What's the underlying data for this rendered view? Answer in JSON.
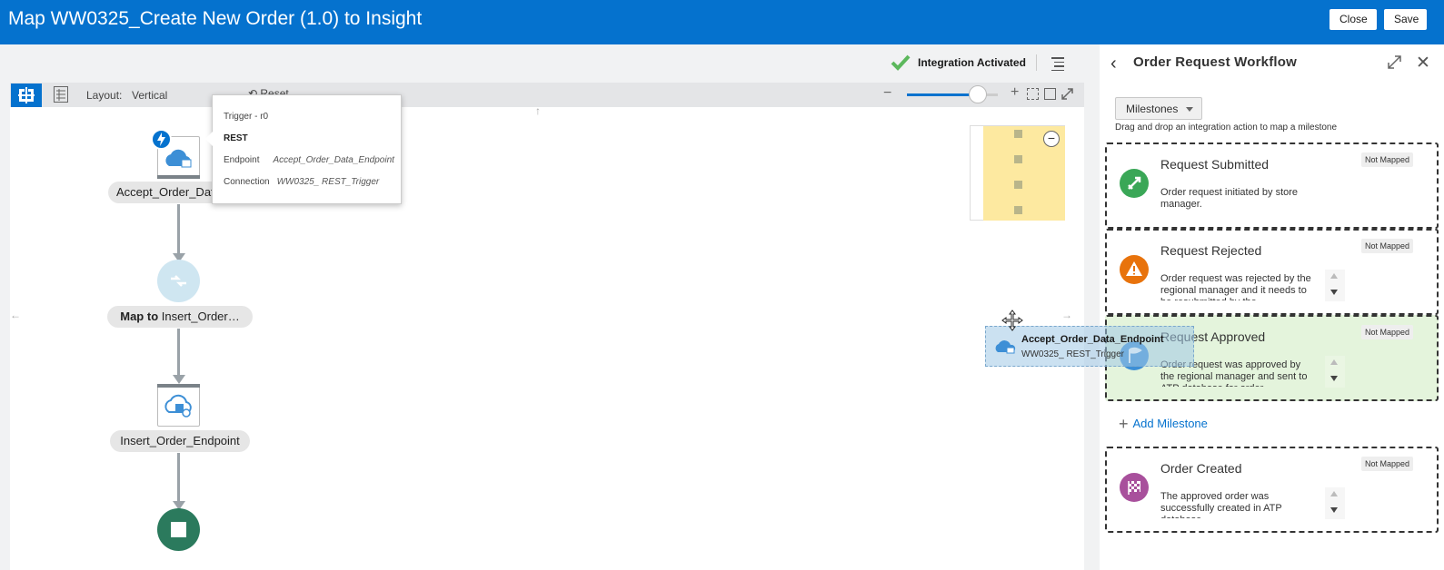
{
  "header": {
    "title": "Map WW0325_Create New Order (1.0) to Insight",
    "close_label": "Close",
    "save_label": "Save"
  },
  "status": {
    "text": "Integration Activated",
    "icon": "check-icon"
  },
  "toolbar": {
    "layout_label": "Layout:",
    "layout_value": "Vertical",
    "reset_label": "Reset",
    "zoom_level": 0.78
  },
  "flow": {
    "trigger_node": {
      "label": "Accept_Order_Data_Endpoint",
      "icon": "cloud-rest-icon"
    },
    "map_node": {
      "prefix": "Map to",
      "label": "Insert_Order…"
    },
    "invoke_node": {
      "label": "Insert_Order_Endpoint",
      "icon": "cloud-db-icon"
    },
    "end_node": {
      "icon": "stop-icon"
    }
  },
  "popup": {
    "trigger_label": "Trigger - r0",
    "type_label": "REST",
    "endpoint_label": "Endpoint",
    "endpoint_value": "Accept_Order_Data_Endpoint",
    "connection_label": "Connection",
    "connection_value": "WW0325_ REST_Trigger"
  },
  "drag_ghost": {
    "name": "Accept_Order_Data_Endpoint",
    "connection": "WW0325_ REST_Trigger"
  },
  "panel": {
    "title": "Order Request Workflow",
    "dropdown_label": "Milestones",
    "hint": "Drag and drop an integration action to map a milestone",
    "add_label": "Add Milestone",
    "milestones": [
      {
        "title": "Request Submitted",
        "desc": "Order request initiated by store manager.",
        "badge": "Not Mapped",
        "color": "#3aa757",
        "icon": "rocket-icon"
      },
      {
        "title": "Request Rejected",
        "desc": "Order request was rejected by the regional manager and it needs to be resubmitted by the",
        "badge": "Not Mapped",
        "color": "#e8730c",
        "icon": "warning-icon"
      },
      {
        "title": "Request Approved",
        "desc": "Order request was approved by the regional manager and sent to ATP database for order",
        "badge": "Not Mapped",
        "color": "#3d8fd6",
        "icon": "flag-icon"
      },
      {
        "title": "Order Created",
        "desc": "The approved order was successfully created in ATP database",
        "badge": "Not Mapped",
        "color": "#a8509c",
        "icon": "checkered-flag-icon"
      }
    ]
  }
}
